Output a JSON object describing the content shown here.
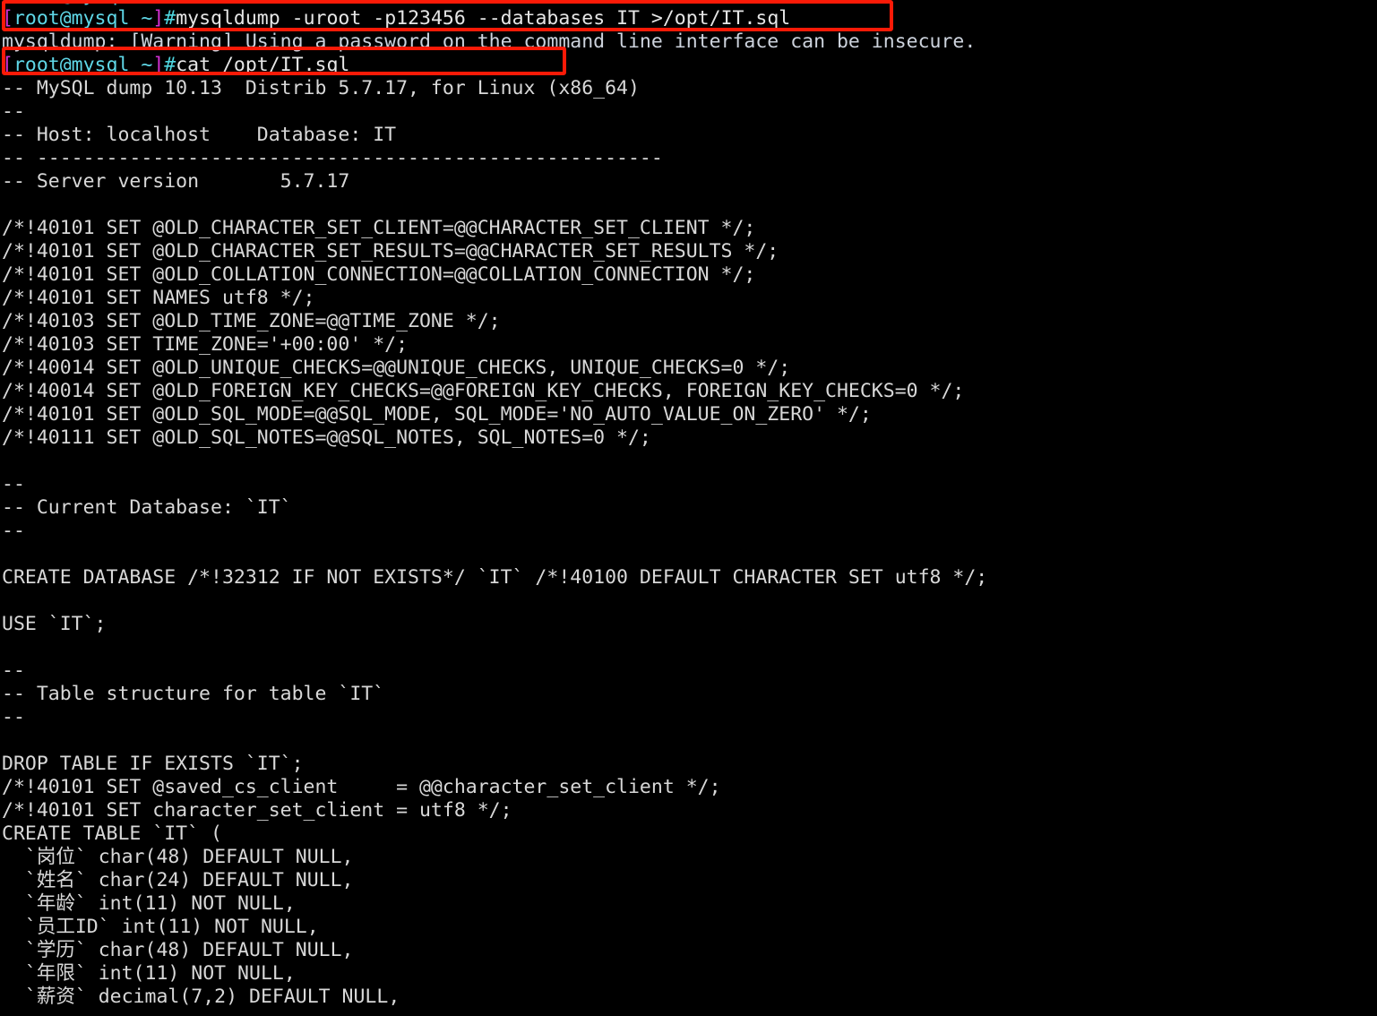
{
  "terminal": {
    "title": "root@mysql terminal",
    "background_color": "#000000",
    "foreground_color": "#d8d8d8",
    "prompt_bracket_color": "#d330d3",
    "prompt_user_color": "#5fd7e7",
    "highlight_color": "#fb1a07",
    "prompt": {
      "open_bracket": "[",
      "user_host": "root@mysql ~",
      "close_bracket": "]",
      "hash": "#"
    },
    "commands": {
      "dump_command": "mysqldump -uroot -p123456 --databases IT >/opt/IT.sql",
      "cat_command": "cat /opt/IT.sql"
    },
    "warning_line": "mysqldump: [Warning] Using a password on the command line interface can be insecure.",
    "annotations": {
      "box_dump_label": "highlight-mysqldump-command",
      "box_cat_label": "highlight-cat-command"
    },
    "output_lines": [
      "-- MySQL dump 10.13  Distrib 5.7.17, for Linux (x86_64)",
      "--",
      "-- Host: localhost    Database: IT",
      "-- ------------------------------------------------------",
      "-- Server version       5.7.17",
      "",
      "/*!40101 SET @OLD_CHARACTER_SET_CLIENT=@@CHARACTER_SET_CLIENT */;",
      "/*!40101 SET @OLD_CHARACTER_SET_RESULTS=@@CHARACTER_SET_RESULTS */;",
      "/*!40101 SET @OLD_COLLATION_CONNECTION=@@COLLATION_CONNECTION */;",
      "/*!40101 SET NAMES utf8 */;",
      "/*!40103 SET @OLD_TIME_ZONE=@@TIME_ZONE */;",
      "/*!40103 SET TIME_ZONE='+00:00' */;",
      "/*!40014 SET @OLD_UNIQUE_CHECKS=@@UNIQUE_CHECKS, UNIQUE_CHECKS=0 */;",
      "/*!40014 SET @OLD_FOREIGN_KEY_CHECKS=@@FOREIGN_KEY_CHECKS, FOREIGN_KEY_CHECKS=0 */;",
      "/*!40101 SET @OLD_SQL_MODE=@@SQL_MODE, SQL_MODE='NO_AUTO_VALUE_ON_ZERO' */;",
      "/*!40111 SET @OLD_SQL_NOTES=@@SQL_NOTES, SQL_NOTES=0 */;",
      "",
      "--",
      "-- Current Database: `IT`",
      "--",
      "",
      "CREATE DATABASE /*!32312 IF NOT EXISTS*/ `IT` /*!40100 DEFAULT CHARACTER SET utf8 */;",
      "",
      "USE `IT`;",
      "",
      "--",
      "-- Table structure for table `IT`",
      "--",
      "",
      "DROP TABLE IF EXISTS `IT`;",
      "/*!40101 SET @saved_cs_client     = @@character_set_client */;",
      "/*!40101 SET character_set_client = utf8 */;",
      "CREATE TABLE `IT` (",
      "  `岗位` char(48) DEFAULT NULL,",
      "  `姓名` char(24) DEFAULT NULL,",
      "  `年龄` int(11) NOT NULL,",
      "  `员工ID` int(11) NOT NULL,",
      "  `学历` char(48) DEFAULT NULL,",
      "  `年限` int(11) NOT NULL,",
      "  `薪资` decimal(7,2) DEFAULT NULL,"
    ]
  }
}
